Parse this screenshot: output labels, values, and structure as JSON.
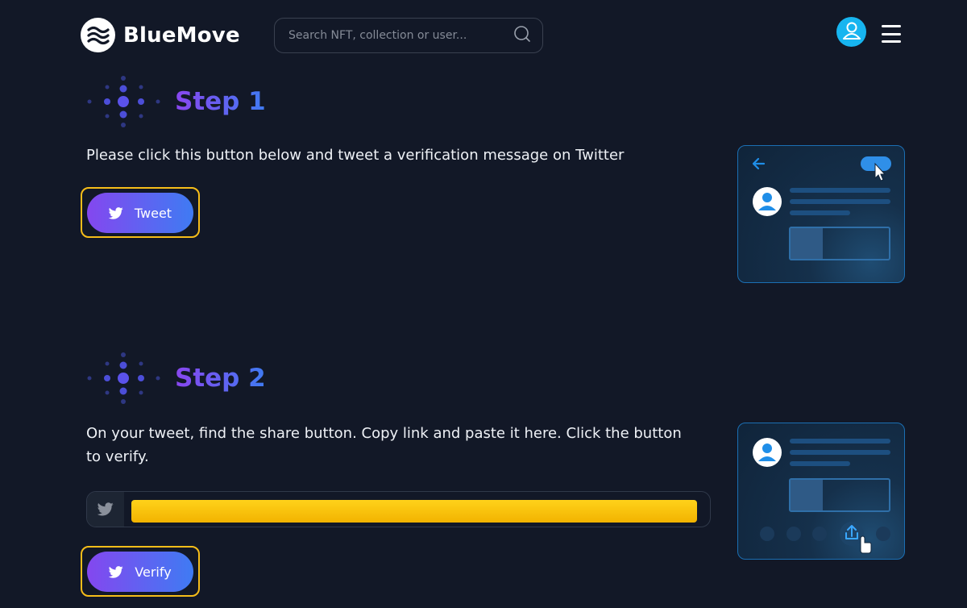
{
  "header": {
    "brand": "BlueMove",
    "search_placeholder": "Search NFT, collection or user..."
  },
  "step1": {
    "title": "Step 1",
    "description": "Please click this button below and tweet a verification message on Twitter",
    "button_label": "Tweet"
  },
  "step2": {
    "title": "Step 2",
    "description_line1": "On your tweet, find the share button. Copy link and paste it here. Click the button",
    "description_line2": "to verify.",
    "link_value": "",
    "button_label": "Verify"
  },
  "icons": {
    "logo": "waves-logo-icon",
    "search": "search-icon",
    "avatar": "user-icon",
    "menu": "hamburger-menu-icon",
    "twitter": "twitter-bird-icon",
    "back": "arrow-left-icon",
    "share": "share-upload-icon",
    "cursor": "pointer-cursor-icon"
  },
  "colors": {
    "background": "#121827",
    "accent_start": "#8447ef",
    "accent_end": "#3f7bf3",
    "highlight": "#f6bd19",
    "avatar": "#17b5f0"
  }
}
